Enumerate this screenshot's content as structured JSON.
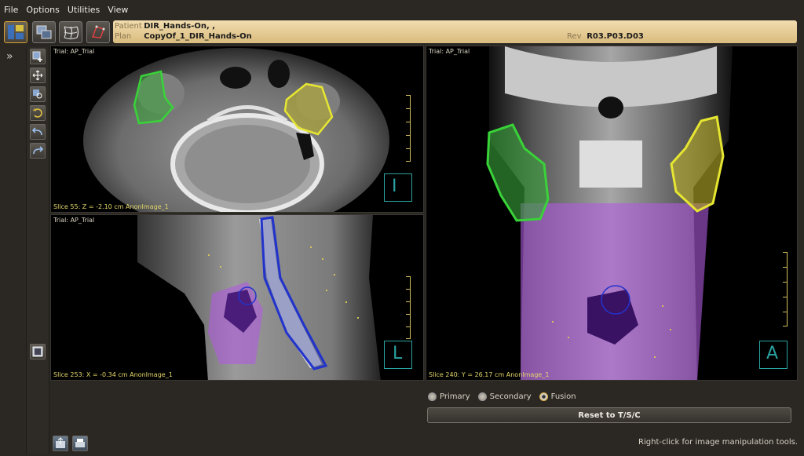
{
  "menu": [
    "File",
    "Options",
    "Utilities",
    "View"
  ],
  "patient": {
    "patient_label": "Patient",
    "patient_name": "DIR_Hands-On, ,",
    "plan_label": "Plan",
    "plan_name": "CopyOf_1_DIR_Hands-On",
    "rev_label": "Rev",
    "rev_value": "R03.P03.D03"
  },
  "viewports": {
    "axial": {
      "title": "Trial: AP_Trial",
      "slice": "Slice 55: Z = -2.10 cm AnonImage_1",
      "orientation": "I"
    },
    "sagittal": {
      "title": "Trial: AP_Trial",
      "slice": "Slice 253: X = -0.34 cm AnonImage_1",
      "orientation": "L"
    },
    "coronal": {
      "title": "Trial: AP_Trial",
      "slice": "Slice 240: Y = 26.17 cm AnonImage_1",
      "orientation": "A"
    }
  },
  "display_mode": {
    "options": [
      "Primary",
      "Secondary",
      "Fusion"
    ],
    "selected": "Fusion"
  },
  "reset_button": "Reset to T/S/C",
  "hint": "Right-click for image manipulation tools.",
  "colors": {
    "accent": "#d8a02e",
    "contour_green": "#39d339",
    "contour_yellow": "#e6e632",
    "contour_blue": "#2233cc",
    "fusion_purple": "#b05ae0"
  }
}
